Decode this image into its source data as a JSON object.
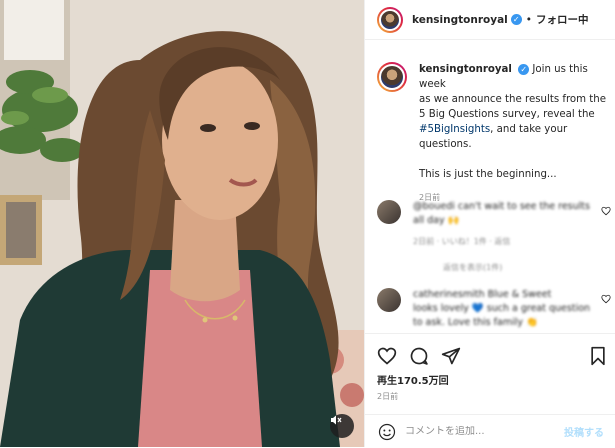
{
  "post": {
    "username": "kensingtonroyal",
    "follow_status": "フォロー中",
    "caption_line1": "Join us this week",
    "caption_line2": "as we announce the results from the",
    "caption_line3": "5 Big Questions survey, reveal the",
    "hashtag": "#5BigInsights",
    "caption_line4_rest": ", and take your",
    "caption_line5": "questions.",
    "caption_line6": "This is just the beginning...",
    "caption_time": "2日前"
  },
  "comments": [
    {
      "line1": "@bouedi can't wait to see the results",
      "line2": "all day 🙌",
      "meta": "2日前 · いいね！1件 · 返信"
    },
    {
      "line1": "catherinesmith Blue & Sweet",
      "line2": "looks lovely 💙 such a great question",
      "line3": "to ask. Love this family 👏",
      "meta": ""
    }
  ],
  "replies_label": "返信を表示(1件)",
  "views": "再生170.5万回",
  "post_time": "2日前",
  "comment_placeholder": "コメントを追加...",
  "post_button": "投稿する",
  "icons": {
    "mute": "speaker-muted-icon",
    "heart": "heart-icon",
    "comment": "comment-icon",
    "share": "share-icon",
    "bookmark": "bookmark-icon",
    "emoji": "emoji-icon",
    "verified": "verified-badge-icon"
  },
  "colors": {
    "link": "#00376b",
    "verified": "#3897f0",
    "muted_text": "#8e8e8e",
    "post_button": "#b2dffc"
  }
}
